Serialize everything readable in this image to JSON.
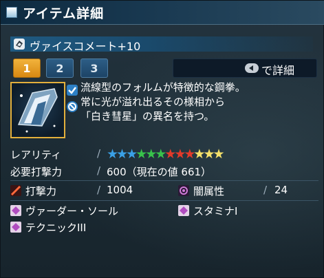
{
  "window": {
    "title": "アイテム詳細"
  },
  "item": {
    "name": "ヴァイスコメート+10"
  },
  "tabs": [
    "1",
    "2",
    "3"
  ],
  "detail_button": {
    "label": "で詳細"
  },
  "description": {
    "lines": [
      "流線型のフォルムが特徴的な鋼拳。",
      "常に光が溢れ出るその様相から",
      "「白き彗星」の異名を持つ。"
    ]
  },
  "rarity": {
    "label": "レアリティ",
    "stars": [
      {
        "color": "#3aa0e6"
      },
      {
        "color": "#3aa0e6"
      },
      {
        "color": "#3aa0e6"
      },
      {
        "color": "#38c24b"
      },
      {
        "color": "#38c24b"
      },
      {
        "color": "#38c24b"
      },
      {
        "color": "#e33a2a"
      },
      {
        "color": "#e33a2a"
      },
      {
        "color": "#e33a2a"
      },
      {
        "color": "#f4e06a"
      },
      {
        "color": "#f4e06a"
      },
      {
        "color": "#f4e06a"
      }
    ]
  },
  "requirement": {
    "label": "必要打撃力",
    "value": "600（現在の値 661）"
  },
  "attack": {
    "label": "打撃力",
    "value": "1004"
  },
  "element": {
    "label": "闇属性",
    "value": "24"
  },
  "affixes": [
    "ヴァーダー・ソール",
    "スタミナI",
    "テクニックIII"
  ],
  "colors": {
    "active_tab": "#e89a20",
    "inactive_tab": "#24507a"
  }
}
